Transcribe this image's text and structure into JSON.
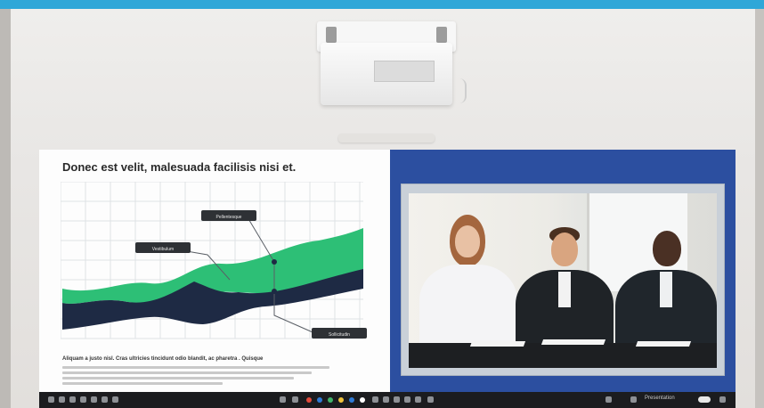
{
  "photo": {
    "subject": "office wall with ceiling projector projecting a presentation and video call"
  },
  "slide": {
    "title": "Donec est velit, malesuada facilisis nisi et.",
    "caption": "Aliquam a justo nisl. Cras ultricies tincidunt odio blandit, ac pharetra . Quisque",
    "chart_labels": [
      "Pellentesque",
      "Vestibulum",
      "Sollicitudin"
    ],
    "colors": {
      "green": "#2dbf76",
      "navy": "#1e2a44",
      "grid": "#d9dcdf"
    }
  },
  "video_call": {
    "panel_color": "#2c4fa0",
    "participants": [
      "woman-left",
      "man-center",
      "man-right"
    ]
  },
  "taskbar": {
    "toggle_label": "Presentation"
  }
}
